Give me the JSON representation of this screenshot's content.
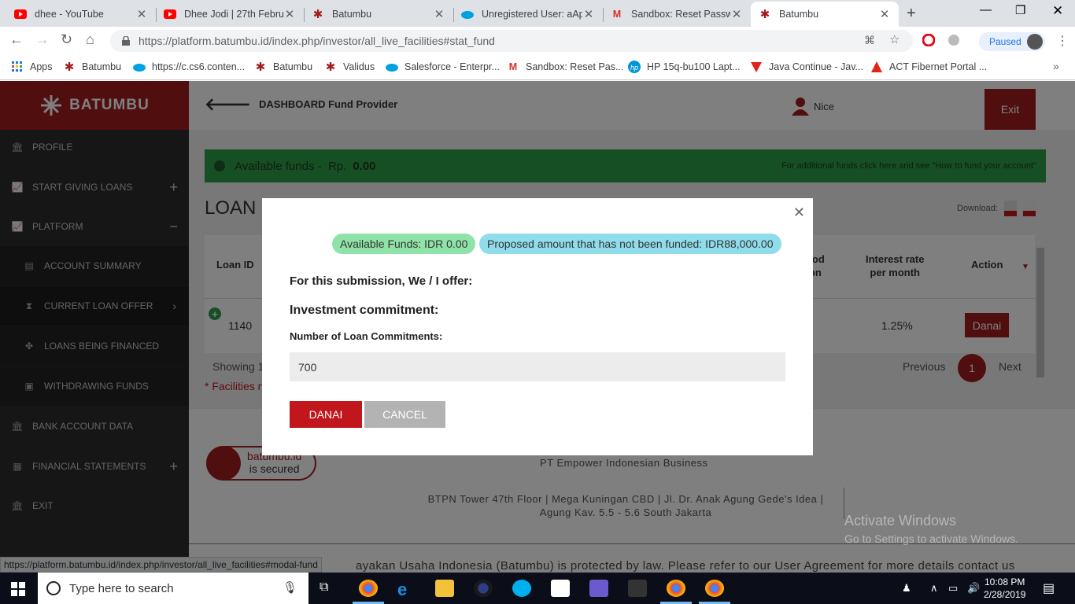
{
  "browser": {
    "tabs": [
      {
        "title": "dhee - YouTube",
        "icon": "youtube-icon",
        "color": "#ff0000"
      },
      {
        "title": "Dhee Jodi | 27th Februa",
        "icon": "youtube-icon",
        "color": "#ff0000"
      },
      {
        "title": "Batumbu",
        "icon": "batumbu-icon",
        "color": "#a21c1f"
      },
      {
        "title": "Unregistered User: aAp",
        "icon": "salesforce-icon",
        "color": "#00a1e0"
      },
      {
        "title": "Sandbox: Reset Passwo",
        "icon": "gmail-icon",
        "color": "#d93025"
      },
      {
        "title": "Batumbu",
        "icon": "batumbu-icon",
        "color": "#a21c1f"
      }
    ],
    "url": "https://platform.batumbu.id/index.php/investor/all_live_facilities#stat_fund",
    "profile_status": "Paused",
    "bookmarks": [
      {
        "label": "Apps",
        "icon": "apps-grid-icon"
      },
      {
        "label": "Batumbu",
        "icon": "batumbu-icon"
      },
      {
        "label": "https://c.cs6.conten...",
        "icon": "salesforce-icon"
      },
      {
        "label": "Batumbu",
        "icon": "batumbu-icon"
      },
      {
        "label": "Validus",
        "icon": "validus-icon"
      },
      {
        "label": "Salesforce - Enterpr...",
        "icon": "salesforce-icon"
      },
      {
        "label": "Sandbox: Reset Pas...",
        "icon": "gmail-icon"
      },
      {
        "label": "HP 15q-bu100 Lapt...",
        "icon": "hp-icon"
      },
      {
        "label": "Java Continue - Jav...",
        "icon": "java-icon"
      },
      {
        "label": "ACT Fibernet Portal ...",
        "icon": "act-icon"
      }
    ],
    "status_url": "https://platform.batumbu.id/index.php/investor/all_live_facilities#modal-fund"
  },
  "sidebar": {
    "brand": "BATUMBU",
    "items": [
      {
        "label": "PROFILE",
        "icon": "bank-icon"
      },
      {
        "label": "START GIVING LOANS",
        "icon": "chart-icon",
        "toggle": "+"
      },
      {
        "label": "PLATFORM",
        "icon": "chart-icon",
        "toggle": "−"
      },
      {
        "label": "ACCOUNT SUMMARY",
        "icon": "document-icon"
      },
      {
        "label": "CURRENT LOAN OFFER",
        "icon": "hourglass-icon",
        "toggle": "›"
      },
      {
        "label": "LOANS BEING FINANCED",
        "icon": "puzzle-icon"
      },
      {
        "label": "WITHDRAWING FUNDS",
        "icon": "money-icon"
      },
      {
        "label": "BANK ACCOUNT DATA",
        "icon": "bank-icon"
      },
      {
        "label": "FINANCIAL STATEMENTS",
        "icon": "calculator-icon",
        "toggle": "+"
      },
      {
        "label": "EXIT",
        "icon": "bank-icon"
      }
    ]
  },
  "header": {
    "title": "DASHBOARD Fund Provider",
    "user": "Nice",
    "exit": "Exit"
  },
  "main": {
    "alert_prefix": "Available funds -  Rp.",
    "alert_amount": "0.00",
    "alert_hint": "For additional funds click here and see \"How to fund your account\"",
    "heading": "LOAN C",
    "download_label": "Download:",
    "table": {
      "headers": {
        "loan_id": "Loan ID",
        "period": "eriod\ntion",
        "interest": "Interest rate\nper month",
        "action": "Action"
      },
      "row": {
        "loan_id": "1140",
        "interest": "1.25%",
        "action": "Danai"
      }
    },
    "showing": "Showing 1",
    "pager": {
      "previous": "Previous",
      "current": "1",
      "next": "Next"
    },
    "facilities_note": "* Facilities n"
  },
  "footer": {
    "secured_line1": "batumbu.id",
    "secured_line2": "is secured",
    "company": "PT Empower Indonesian Business",
    "address": "BTPN Tower 47th Floor | Mega Kuningan CBD | Jl. Dr. Anak Agung Gede's Idea | Agung Kav. 5.5 - 5.6 South Jakarta",
    "legal": "ayakan Usaha Indonesia (Batumbu) is protected by law. Please refer to our User Agreement for more details contact us"
  },
  "watermark": {
    "line1": "Activate Windows",
    "line2": "Go to Settings to activate Windows."
  },
  "modal": {
    "available_funds": "Available Funds: IDR 0.00",
    "proposed_amount": "Proposed amount that has not been funded: IDR88,000.00",
    "offer_text": "For this submission, We / I offer:",
    "commitment_heading": "Investment commitment:",
    "field_label": "Number of Loan Commitments:",
    "field_value": "700",
    "submit_label": "DANAI",
    "cancel_label": "CANCEL"
  },
  "taskbar": {
    "search_placeholder": "Type here to search",
    "time": "10:08 PM",
    "date": "2/28/2019"
  }
}
